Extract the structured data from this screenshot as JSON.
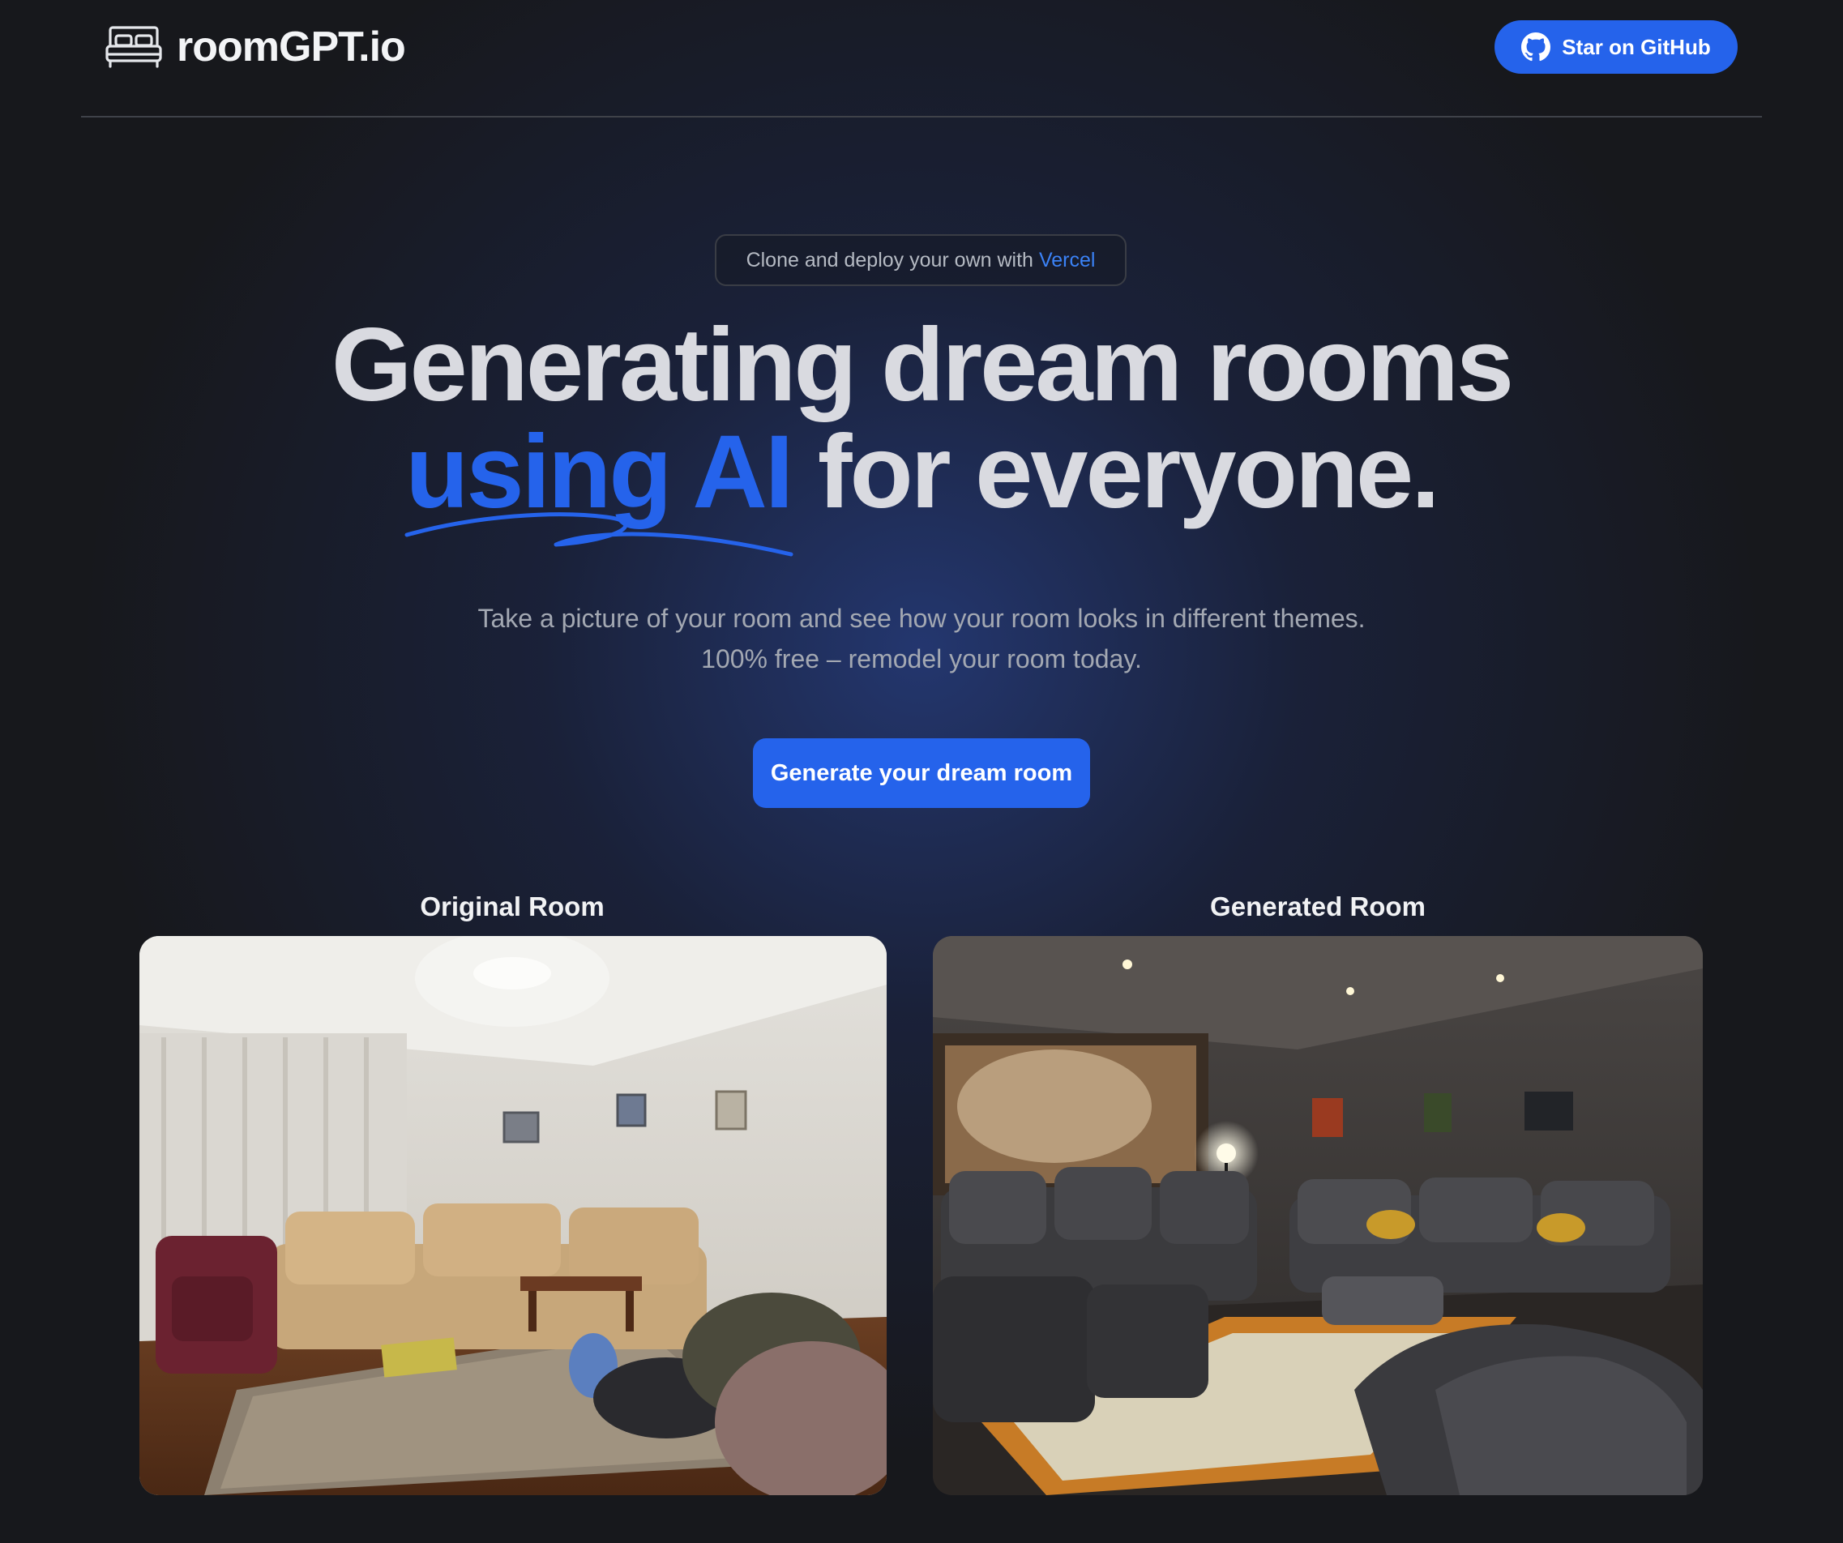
{
  "header": {
    "logo_text": "roomGPT.io",
    "github_button_label": "Star on GitHub"
  },
  "hero": {
    "pill_text": "Clone and deploy your own with",
    "pill_link": "Vercel",
    "headline_line1": "Generating dream rooms",
    "headline_accent": "using AI",
    "headline_rest": "for everyone.",
    "subtext": "Take a picture of your room and see how your room looks in different themes. 100% free – remodel your room today.",
    "cta_label": "Generate your dream room"
  },
  "comparison": {
    "original_label": "Original Room",
    "generated_label": "Generated Room"
  },
  "colors": {
    "background": "#17181c",
    "accent": "#2563eb",
    "heading": "#d9dae0",
    "muted_text": "#a3a8b2"
  },
  "icons": {
    "logo": "bed-icon",
    "github": "github-icon"
  }
}
